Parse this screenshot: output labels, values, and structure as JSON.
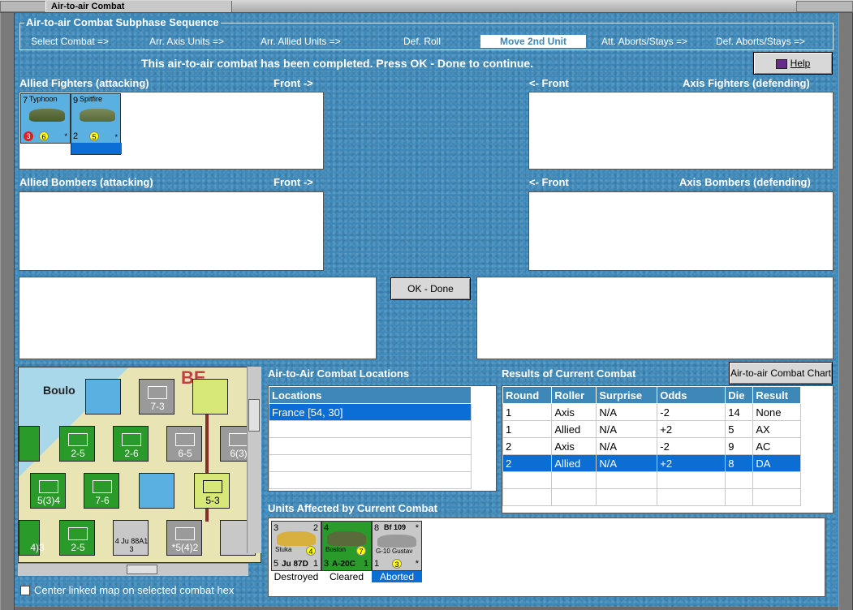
{
  "window": {
    "title": "Air-to-air Combat"
  },
  "sequence": {
    "legend": "Air-to-air Combat Subphase Sequence",
    "steps": [
      "Select Combat =>",
      "Arr. Axis Units =>",
      "Arr. Allied Units =>",
      "Def. Roll",
      "Move 2nd Unit",
      "Att. Aborts/Stays =>",
      "Def. Aborts/Stays =>"
    ],
    "active_step": "Move 2nd Unit"
  },
  "message": "This air-to-air combat has been completed.  Press OK - Done to continue.",
  "help_label": "Help",
  "sections": {
    "allied_fighters": "Allied Fighters (attacking)",
    "allied_fighters_front": "Front ->",
    "axis_fighters_front": "<- Front",
    "axis_fighters": "Axis Fighters (defending)",
    "allied_bombers": "Allied Bombers (attacking)",
    "allied_bombers_front": "Front ->",
    "axis_bombers_front": "<- Front",
    "axis_bombers": "Axis Bombers (defending)"
  },
  "allied_fighter_counters": [
    {
      "name": "Typhoon",
      "sub": "IB",
      "top_left": "7",
      "top_right": "1",
      "red": "3",
      "yellow": "6",
      "star": "*"
    },
    {
      "name": "Spitfire",
      "sub": "XIV",
      "top_left": "9",
      "top_right": "*",
      "bottom_left": "2",
      "yellow": "5",
      "star": "*"
    }
  ],
  "ok_done_label": "OK - Done",
  "combat_chart_label": "Air-to-air Combat Chart",
  "locations": {
    "title": "Air-to-Air Combat Locations",
    "header": "Locations",
    "rows": [
      "France [54, 30]"
    ]
  },
  "results": {
    "title": "Results of Current Combat",
    "columns": [
      "Round",
      "Roller",
      "Surprise",
      "Odds",
      "Die",
      "Result"
    ],
    "rows": [
      [
        "1",
        "Axis",
        "N/A",
        "-2",
        "14",
        "None"
      ],
      [
        "1",
        "Allied",
        "N/A",
        "+2",
        "5",
        "AX"
      ],
      [
        "2",
        "Axis",
        "N/A",
        "-2",
        "9",
        "AC"
      ],
      [
        "2",
        "Allied",
        "N/A",
        "+2",
        "8",
        "DA"
      ]
    ],
    "selected_row": 3
  },
  "affected": {
    "title": "Units Affected by Current Combat",
    "units": [
      {
        "name": "Stuka",
        "model": "Ju 87D",
        "top_left": "3",
        "top_right": "2",
        "bottom_left": "5",
        "bottom_right": "1",
        "yellow": "4",
        "status": "Destroyed"
      },
      {
        "name": "Boston",
        "model": "A-20C",
        "top_left": "4",
        "top_right": "",
        "bottom_left": "3",
        "bottom_right": "1",
        "yellow": "7",
        "status": "Cleared"
      },
      {
        "name": "Bf 109",
        "model": "G-10 Gustav",
        "top_left": "8",
        "top_right": "*",
        "bottom_left": "1",
        "bottom_right": "*",
        "yellow": "3",
        "status": "Aborted"
      }
    ],
    "selected": "Aborted"
  },
  "center_checkbox_label": "Center linked map on selected combat hex",
  "map": {
    "place_label": "Boulo",
    "units": [
      {
        "label": "7-3",
        "color": "#9a9a9a"
      },
      {
        "label": "2-5",
        "color": "#2a9a2a"
      },
      {
        "label": "2-6",
        "color": "#2a9a2a"
      },
      {
        "label": "6-5",
        "color": "#9a9a9a"
      },
      {
        "label": "6(3)",
        "color": "#9a9a9a"
      },
      {
        "label": "5(3)4",
        "color": "#2a9a2a"
      },
      {
        "label": "7-6",
        "color": "#2a9a2a"
      },
      {
        "label": "5-3",
        "color": "#c8d878"
      },
      {
        "label": "2-5",
        "color": "#2a9a2a"
      },
      {
        "label": "4 Ju 88A1 3",
        "color": "#c8c8c8"
      },
      {
        "label": "*5(4)2",
        "color": "#9a9a9a"
      },
      {
        "label": "4)3",
        "color": "#2a9a2a"
      }
    ]
  }
}
